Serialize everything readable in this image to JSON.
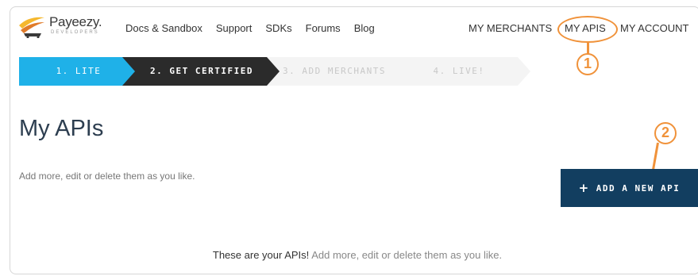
{
  "brand": {
    "name": "Payeezy.",
    "tagline": "DEVELOPERS"
  },
  "nav": {
    "left": [
      "Docs & Sandbox",
      "Support",
      "SDKs",
      "Forums",
      "Blog"
    ],
    "merchants": "MY MERCHANTS",
    "apis": "MY APIS",
    "account": "MY ACCOUNT"
  },
  "steps": [
    "1. LITE",
    "2. GET CERTIFIED",
    "3. ADD MERCHANTS",
    "4. LIVE!"
  ],
  "main": {
    "title": "My APIs",
    "subtitle": "Add more, edit or delete them as you like.",
    "add_button": "ADD A NEW API",
    "footer_strong": "These are your APIs!",
    "footer_soft": "Add more, edit or delete them as you like."
  },
  "annotations": [
    "1",
    "2"
  ],
  "colors": {
    "step_active": "#1fb1e8",
    "step_current": "#2b2b2b",
    "button": "#123e60",
    "annotation": "#f0923a"
  }
}
